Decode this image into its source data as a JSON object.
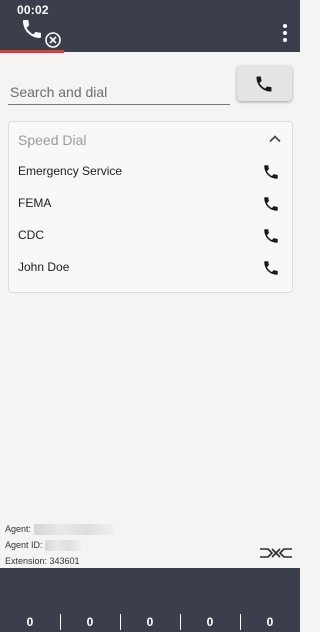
{
  "header": {
    "timer": "00:02",
    "menu_icon": "more-vert-icon",
    "call_icon": "phone-icon",
    "end_icon": "call-end-icon",
    "accent": "#e53935",
    "bar_color": "#3a3f4b"
  },
  "search": {
    "placeholder": "Search and dial",
    "value": ""
  },
  "speed_dial": {
    "title": "Speed Dial",
    "items": [
      {
        "label": "Emergency Service"
      },
      {
        "label": "FEMA"
      },
      {
        "label": "CDC"
      },
      {
        "label": "John Doe"
      }
    ]
  },
  "agent": {
    "agent_label": "Agent:",
    "agent_id_label": "Agent ID:",
    "extension_text": "Extension: 343601"
  },
  "counters": [
    "0",
    "0",
    "0",
    "0",
    "0"
  ]
}
